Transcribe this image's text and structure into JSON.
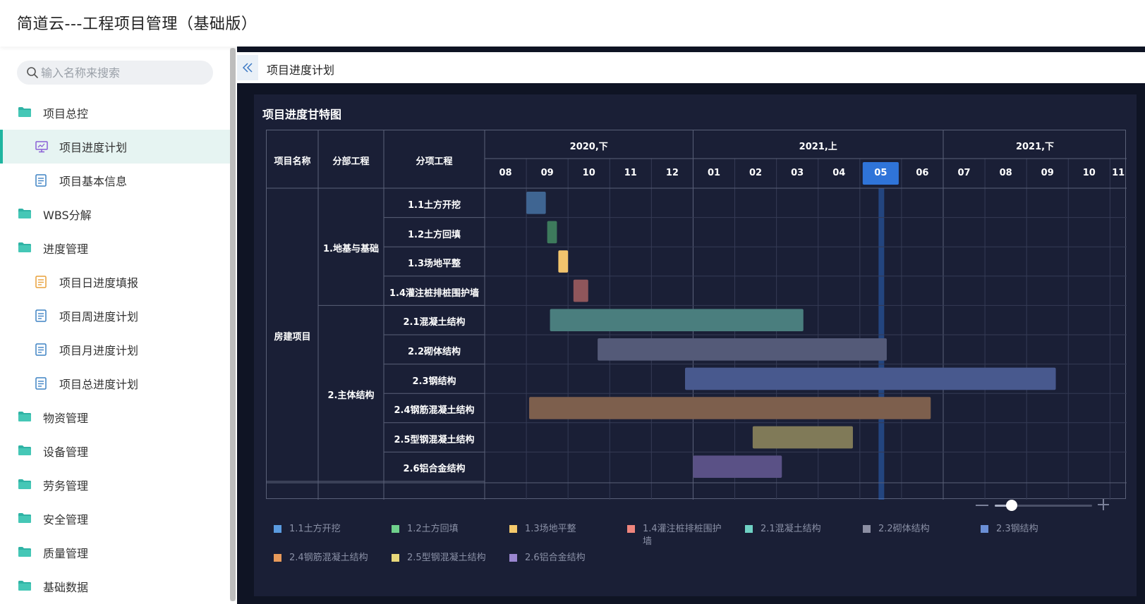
{
  "app": {
    "title": "简道云---工程项目管理（基础版）"
  },
  "search": {
    "placeholder": "输入名称来搜索"
  },
  "sidebar": {
    "items": [
      {
        "label": "项目总控",
        "type": "group",
        "icon": "folder-icon"
      },
      {
        "label": "项目进度计划",
        "type": "sub",
        "icon": "dashboard-icon",
        "active": true
      },
      {
        "label": "项目基本信息",
        "type": "sub",
        "icon": "form-icon"
      },
      {
        "label": "WBS分解",
        "type": "group",
        "icon": "folder-icon"
      },
      {
        "label": "进度管理",
        "type": "group",
        "icon": "folder-icon"
      },
      {
        "label": "项目日进度填报",
        "type": "sub",
        "icon": "form-icon"
      },
      {
        "label": "项目周进度计划",
        "type": "sub",
        "icon": "form-icon"
      },
      {
        "label": "项目月进度计划",
        "type": "sub",
        "icon": "form-icon"
      },
      {
        "label": "项目总进度计划",
        "type": "sub",
        "icon": "form-icon"
      },
      {
        "label": "物资管理",
        "type": "group",
        "icon": "folder-icon"
      },
      {
        "label": "设备管理",
        "type": "group",
        "icon": "folder-icon"
      },
      {
        "label": "劳务管理",
        "type": "group",
        "icon": "folder-icon"
      },
      {
        "label": "安全管理",
        "type": "group",
        "icon": "folder-icon"
      },
      {
        "label": "质量管理",
        "type": "group",
        "icon": "folder-icon"
      },
      {
        "label": "基础数据",
        "type": "group",
        "icon": "folder-icon"
      }
    ]
  },
  "page": {
    "crumb": "项目进度计划"
  },
  "panel": {
    "title": "项目进度甘特图"
  },
  "gantt": {
    "headers": {
      "project": "项目名称",
      "division": "分部工程",
      "item": "分项工程"
    },
    "project_name": "房建项目",
    "divisions": [
      {
        "name": "1.地基与基础",
        "rows": 4
      },
      {
        "name": "2.主体结构",
        "rows": 6
      }
    ],
    "periods": [
      {
        "label": "2020,下",
        "months": 5
      },
      {
        "label": "2021,上",
        "months": 6
      },
      {
        "label": "2021,下",
        "months": 5
      }
    ],
    "months": [
      "08",
      "09",
      "10",
      "11",
      "12",
      "01",
      "02",
      "03",
      "04",
      "05",
      "06",
      "07",
      "08",
      "09",
      "10",
      "11"
    ],
    "current_month": "05"
  },
  "chart_data": {
    "type": "gantt",
    "time_axis": {
      "start": "2020-08",
      "end": "2021-11"
    },
    "tasks": [
      {
        "name": "1.1土方开挖",
        "start": "2020-09-01",
        "end": "2020-09-15",
        "color": "#3f6592"
      },
      {
        "name": "1.2土方回填",
        "start": "2020-09-16",
        "end": "2020-09-23",
        "color": "#3d7a5c"
      },
      {
        "name": "1.3场地平整",
        "start": "2020-09-24",
        "end": "2020-10-01",
        "color": "#f2c46d"
      },
      {
        "name": "1.4灌注桩排桩围护墙",
        "start": "2020-10-05",
        "end": "2020-10-16",
        "color": "#8f565b"
      },
      {
        "name": "2.1混凝土结构",
        "start": "2020-09-18",
        "end": "2021-03-21",
        "color": "#4a7e7e"
      },
      {
        "name": "2.2砌体结构",
        "start": "2020-10-23",
        "end": "2021-05-21",
        "color": "#545a78"
      },
      {
        "name": "2.3钢结构",
        "start": "2020-12-26",
        "end": "2021-09-22",
        "color": "#48598e"
      },
      {
        "name": "2.4钢筋混凝土结构",
        "start": "2020-09-03",
        "end": "2021-06-22",
        "color": "#7d5f4d"
      },
      {
        "name": "2.5型钢混凝土结构",
        "start": "2021-02-13",
        "end": "2021-04-26",
        "color": "#807a58"
      },
      {
        "name": "2.6铝合金结构",
        "start": "2021-01-01",
        "end": "2021-03-05",
        "color": "#5a5186"
      }
    ],
    "today": "2021-05-17"
  },
  "legend": {
    "items": [
      {
        "label": "1.1土方开挖",
        "color": "#5a9be0"
      },
      {
        "label": "1.2土方回填",
        "color": "#6fd08c"
      },
      {
        "label": "1.3场地平整",
        "color": "#f5c96b"
      },
      {
        "label": "1.4灌注桩排桩围护墙",
        "color": "#ef857d"
      },
      {
        "label": "2.1混凝土结构",
        "color": "#6fd1c4"
      },
      {
        "label": "2.2砌体结构",
        "color": "#8c8fa3"
      },
      {
        "label": "2.3钢结构",
        "color": "#6b8fd6"
      },
      {
        "label": "2.4钢筋混凝土结构",
        "color": "#e89a5a"
      },
      {
        "label": "2.5型钢混凝土结构",
        "color": "#e8d87a"
      },
      {
        "label": "2.6铝合金结构",
        "color": "#9a86d0"
      }
    ]
  },
  "colors": {
    "accent": "#1fb5a0",
    "today_highlight": "#2f74d9",
    "panel_bg": "#1a1f36"
  }
}
